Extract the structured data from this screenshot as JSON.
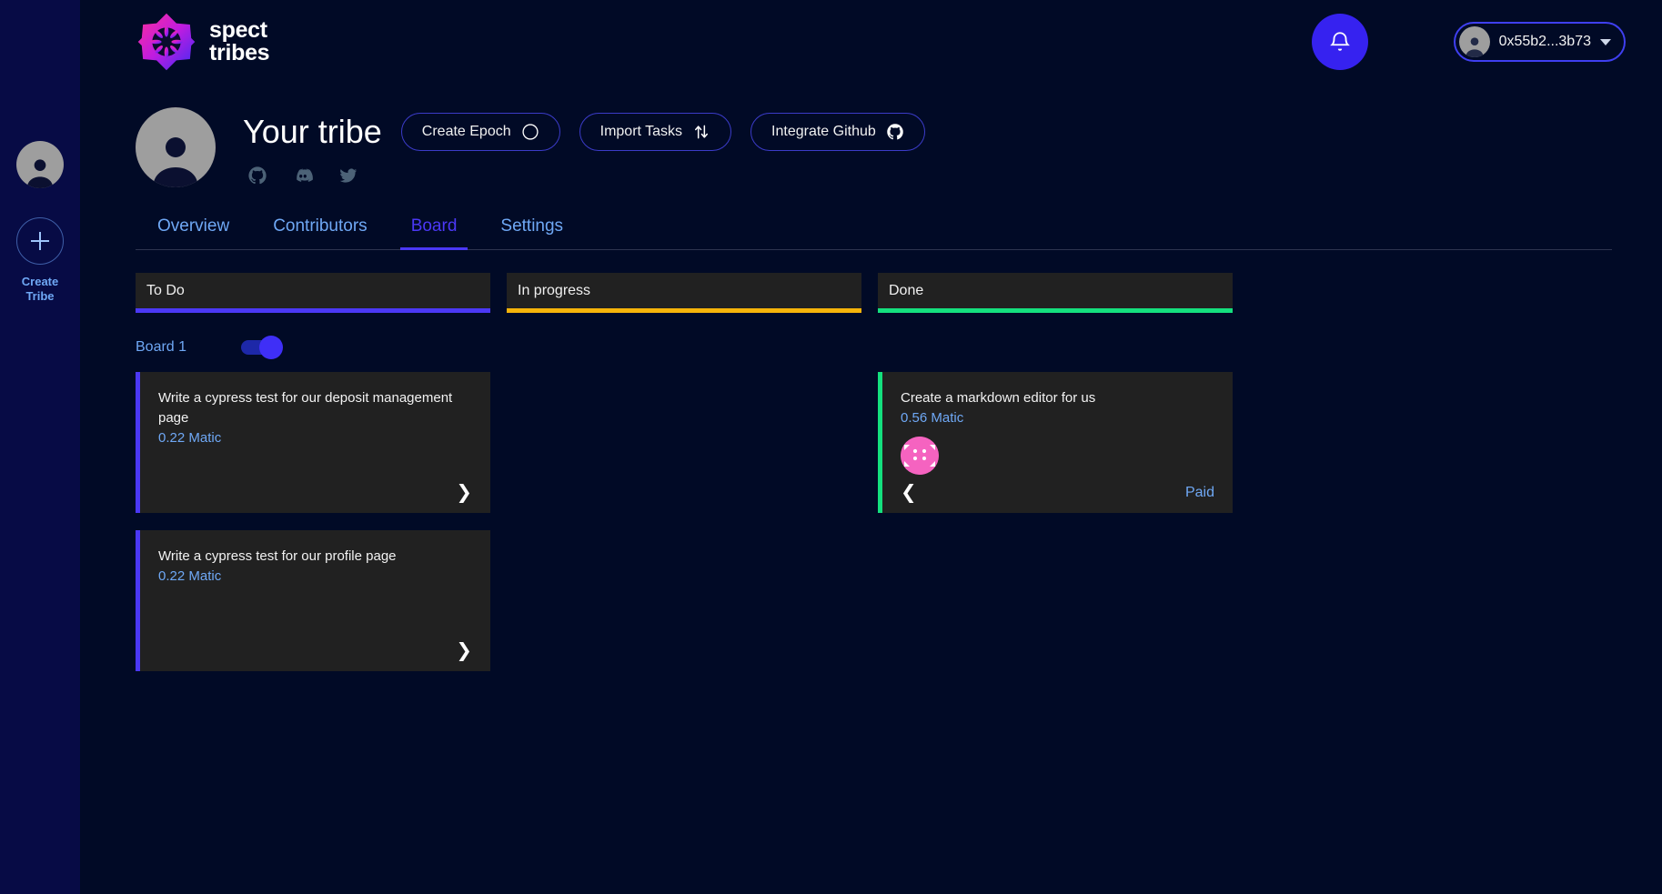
{
  "sidebar": {
    "profile_avatar": "person-avatar",
    "create_tribe": {
      "icon": "plus-icon",
      "label_line1": "Create",
      "label_line2": "Tribe"
    }
  },
  "header": {
    "logo": {
      "icon": "spect-star-logo",
      "line1": "spect",
      "line2": "tribes"
    },
    "notifications": {
      "icon": "bell-icon"
    },
    "wallet": {
      "avatar": "person-avatar",
      "address": "0x55b2...3b73",
      "chevron": "chevron-down-icon"
    }
  },
  "tribe": {
    "avatar": "person-avatar",
    "name": "Your tribe",
    "actions": [
      {
        "label": "Create Epoch",
        "icon": "contrast-moon-icon"
      },
      {
        "label": "Import Tasks",
        "icon": "sort-arrows-icon"
      },
      {
        "label": "Integrate Github",
        "icon": "github-icon"
      }
    ],
    "socials": [
      {
        "name": "github-icon"
      },
      {
        "name": "discord-icon"
      },
      {
        "name": "twitter-icon"
      }
    ]
  },
  "tabs": [
    {
      "label": "Overview",
      "active": false
    },
    {
      "label": "Contributors",
      "active": false
    },
    {
      "label": "Board",
      "active": true
    },
    {
      "label": "Settings",
      "active": false
    }
  ],
  "board": {
    "columns": [
      {
        "title": "To Do",
        "accent": "#4b38f5"
      },
      {
        "title": "In progress",
        "accent": "#f5b40a"
      },
      {
        "title": "Done",
        "accent": "#14e07e"
      }
    ],
    "group": {
      "label": "Board 1",
      "toggle_on": true
    },
    "cards": {
      "todo": [
        {
          "title": "Write a cypress test for our deposit management page",
          "value": "0.22 Matic",
          "chevron": "chevron-right-icon"
        },
        {
          "title": "Write a cypress test for our profile page",
          "value": "0.22 Matic",
          "chevron": "chevron-right-icon"
        }
      ],
      "in_progress": [],
      "done": [
        {
          "title": "Create a markdown editor for us",
          "value": "0.56 Matic",
          "avatar": "pink-identicon-avatar",
          "chevron": "chevron-left-icon",
          "status": "Paid"
        }
      ]
    }
  },
  "colors": {
    "background": "#010a26",
    "sidebar": "#070b45",
    "card": "#212121",
    "accent_purple": "#4b38f5",
    "accent_blue": "#3622f0",
    "link_blue": "#6fa8f5",
    "todo": "#4b38f5",
    "in_progress": "#f5b40a",
    "done": "#14e07e",
    "avatar_pink": "#f563c0"
  }
}
